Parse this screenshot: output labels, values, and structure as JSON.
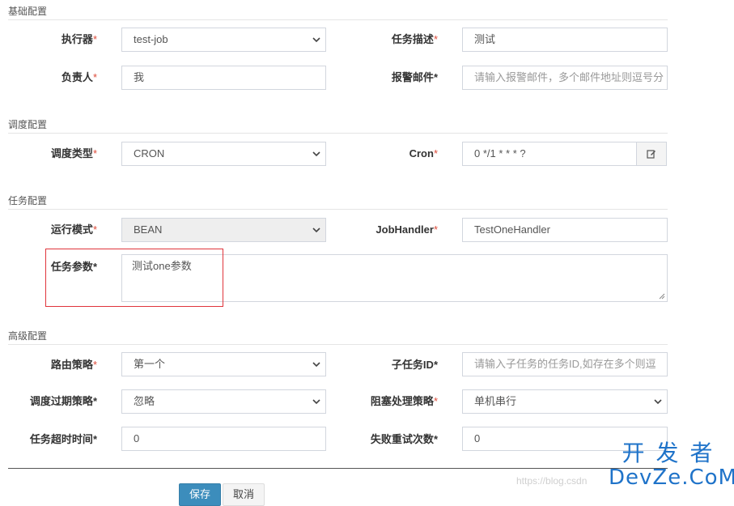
{
  "sections": {
    "basic": "基础配置",
    "schedule": "调度配置",
    "task": "任务配置",
    "advanced": "高级配置"
  },
  "fields": {
    "executor": {
      "label": "执行器",
      "value": "test-job"
    },
    "job_desc": {
      "label": "任务描述",
      "value": "测试"
    },
    "owner": {
      "label": "负责人",
      "value": "我"
    },
    "alarm_email": {
      "label": "报警邮件",
      "placeholder": "请输入报警邮件，多个邮件地址则逗号分"
    },
    "schedule_type": {
      "label": "调度类型",
      "value": "CRON"
    },
    "cron": {
      "label": "Cron",
      "value": "0 */1 * * * ?"
    },
    "run_mode": {
      "label": "运行模式",
      "value": "BEAN"
    },
    "job_handler": {
      "label": "JobHandler",
      "value": "TestOneHandler"
    },
    "task_param": {
      "label": "任务参数",
      "value": "测试one参数"
    },
    "route_strategy": {
      "label": "路由策略",
      "value": "第一个"
    },
    "child_job_id": {
      "label": "子任务ID",
      "placeholder": "请输入子任务的任务ID,如存在多个则逗"
    },
    "misfire_strategy": {
      "label": "调度过期策略",
      "value": "忽略"
    },
    "block_strategy": {
      "label": "阻塞处理策略",
      "value": "单机串行"
    },
    "timeout": {
      "label": "任务超时时间",
      "value": "0"
    },
    "fail_retry": {
      "label": "失败重试次数",
      "value": "0"
    }
  },
  "required_mark": "*",
  "buttons": {
    "save": "保存",
    "cancel": "取消"
  },
  "watermark": {
    "url": "https://blog.csdn",
    "logo_top": "开发者",
    "logo_bottom": "DevZe.CoM"
  },
  "colors": {
    "required": "#dd4b39",
    "primary": "#3c8dbc",
    "highlight": "#e0343b",
    "logo": "#1f73c9"
  }
}
